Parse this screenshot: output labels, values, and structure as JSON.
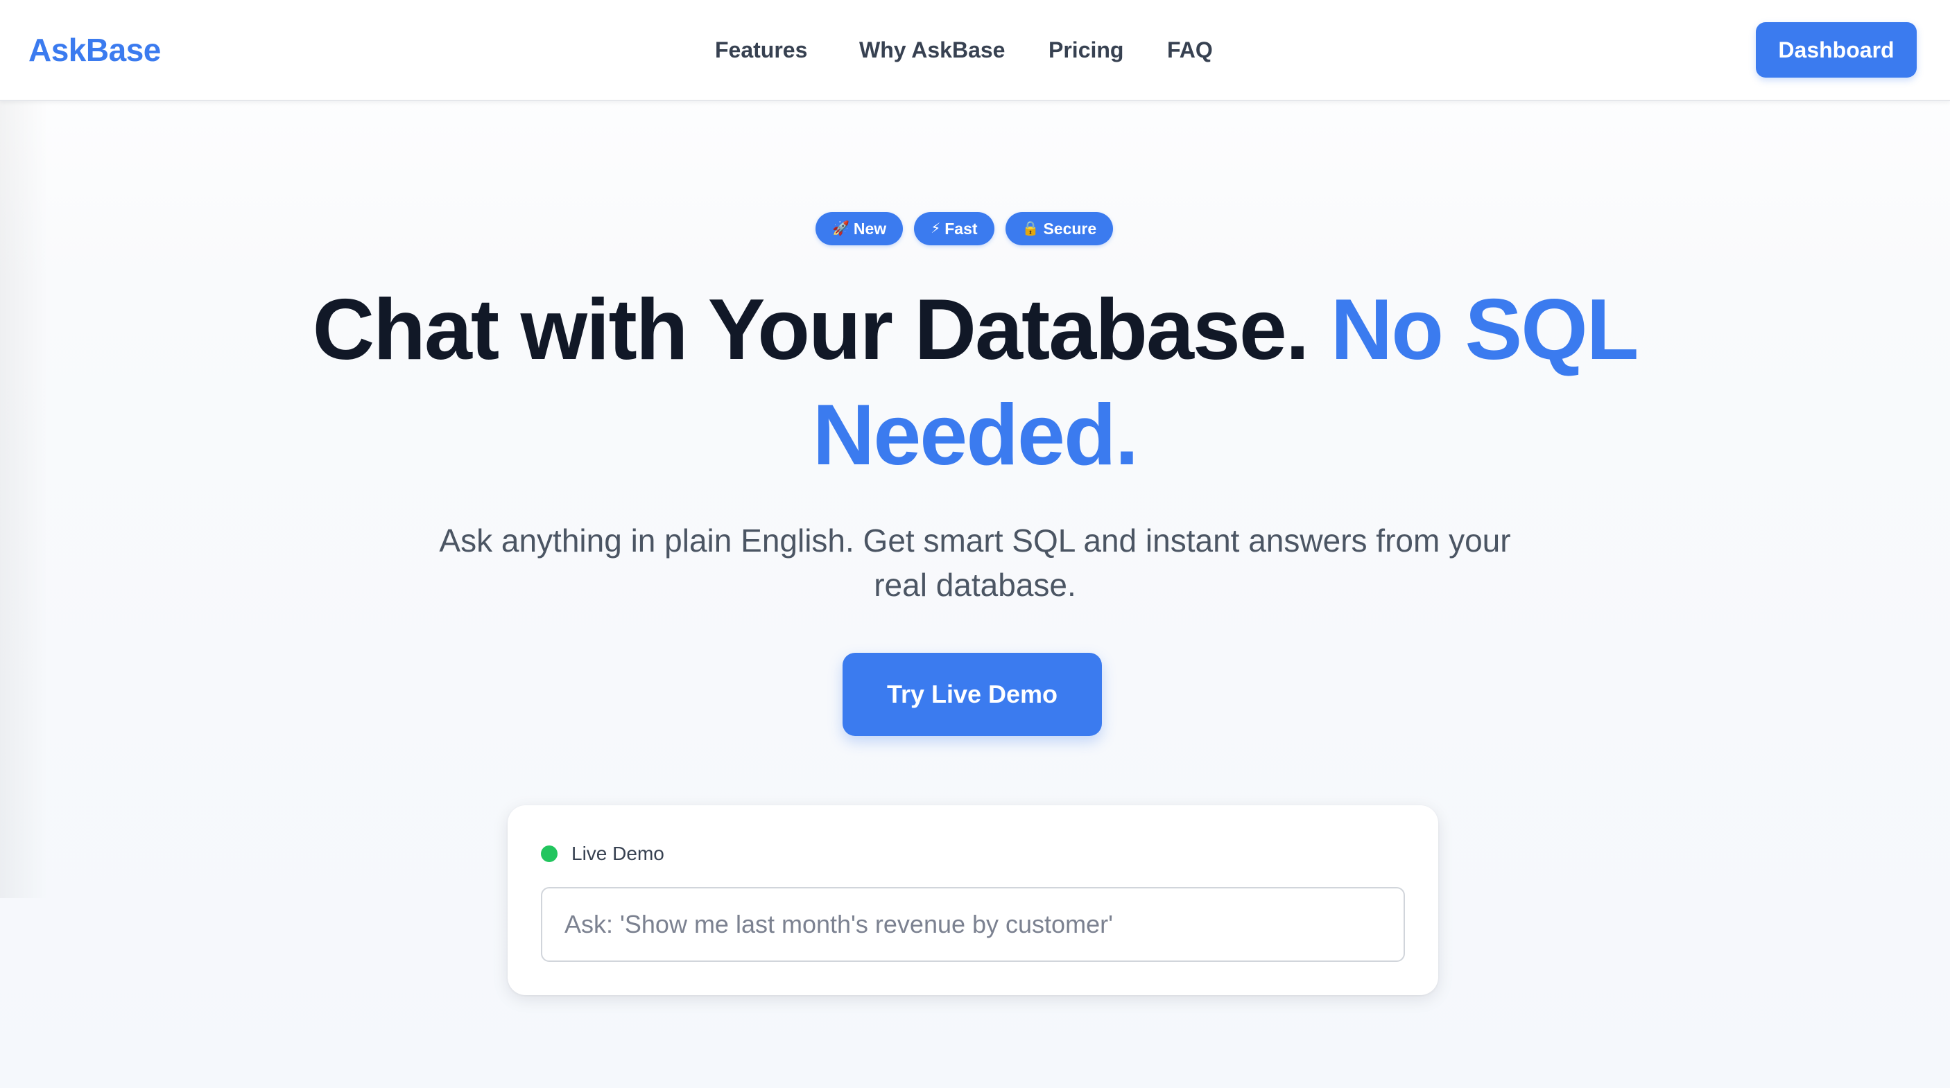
{
  "header": {
    "logo": "AskBase",
    "nav": [
      "Features",
      "Why AskBase",
      "Pricing",
      "FAQ"
    ],
    "dashboard_label": "Dashboard"
  },
  "badges": [
    {
      "icon": "rocket-icon",
      "glyph": "🚀",
      "label": "New"
    },
    {
      "icon": "lightning-icon",
      "glyph": "⚡",
      "label": "Fast"
    },
    {
      "icon": "lock-icon",
      "glyph": "🔒",
      "label": "Secure"
    }
  ],
  "hero": {
    "headline_part1": "Chat with Your Database. ",
    "headline_accent": "No SQL Needed.",
    "subheadline": "Ask anything in plain English. Get smart SQL and instant answers from your real database.",
    "cta_label": "Try Live Demo"
  },
  "demo": {
    "status_label": "Live Demo",
    "input_value": "",
    "input_placeholder": "Ask: 'Show me last month's revenue by customer'"
  },
  "colors": {
    "accent": "#3b7bef",
    "live_indicator": "#22c55e",
    "heading": "#111827",
    "body_text": "#4b5563"
  }
}
